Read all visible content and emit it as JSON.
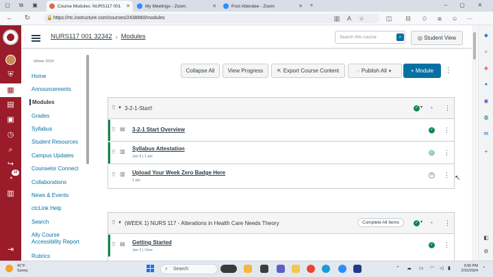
{
  "browser": {
    "tabs": [
      {
        "title": "Course Modules: NURS117 001",
        "active": true
      },
      {
        "title": "My Meetings - Zoom",
        "active": false
      },
      {
        "title": "Post Attendee - Zoom",
        "active": false
      }
    ],
    "url": "https://rtc.instructure.com/courses/2438860/modules"
  },
  "header": {
    "course_link": "NURS117 001 32342",
    "current_page": "Modules",
    "search_placeholder": "Search this course",
    "student_view_label": "Student View"
  },
  "course_nav": {
    "term": "Winter 2024",
    "items": [
      {
        "label": "Home",
        "active": false
      },
      {
        "label": "Announcements",
        "active": false
      },
      {
        "label": "Modules",
        "active": true
      },
      {
        "label": "Grades",
        "active": false
      },
      {
        "label": "Syllabus",
        "active": false
      },
      {
        "label": "Student Resources",
        "active": false
      },
      {
        "label": "Campus Updates",
        "active": false
      },
      {
        "label": "Counselor Connect",
        "active": false
      },
      {
        "label": "Collaborations",
        "active": false
      },
      {
        "label": "News & Events",
        "active": false
      },
      {
        "label": "ctcLink Help",
        "active": false
      },
      {
        "label": "Search",
        "active": false
      },
      {
        "label": "Ally Course",
        "label2": "Accessibility Report",
        "active": false
      },
      {
        "label": "Rubrics",
        "active": false
      }
    ]
  },
  "toolbar": {
    "collapse_all": "Collapse All",
    "view_progress": "View Progress",
    "export_content": "Export Course Content",
    "publish_all": "Publish All",
    "add_module": "Module"
  },
  "modules": [
    {
      "title": "3-2-1-Start!",
      "items": [
        {
          "title": "3-2-1 Start Overview",
          "meta": "",
          "status": "published"
        },
        {
          "title": "Syllabus Attestation",
          "meta": "Jan 5  |  1 pts",
          "status": "published-light"
        },
        {
          "title": "Upload Your Week Zero Badge Here",
          "meta": "1 pts",
          "status": "unpublished"
        }
      ]
    },
    {
      "title": "(WEEK 1) NURS 117 - Alterations in Health Care Needs Theory",
      "complete_all": "Complete All Items",
      "items": [
        {
          "title": "Getting Started",
          "meta": "Jan 2  |  View",
          "status": "published"
        }
      ]
    }
  ],
  "global_nav": {
    "badge_count": "10"
  },
  "taskbar": {
    "weather_temp": "41°F",
    "weather_desc": "Sunny",
    "search_label": "Search",
    "time": "3:00 PM",
    "date": "2/15/2024"
  },
  "colors": {
    "canvas_brand": "#9a1b29",
    "primary_button": "#0770a3",
    "published_green": "#0b874b"
  }
}
